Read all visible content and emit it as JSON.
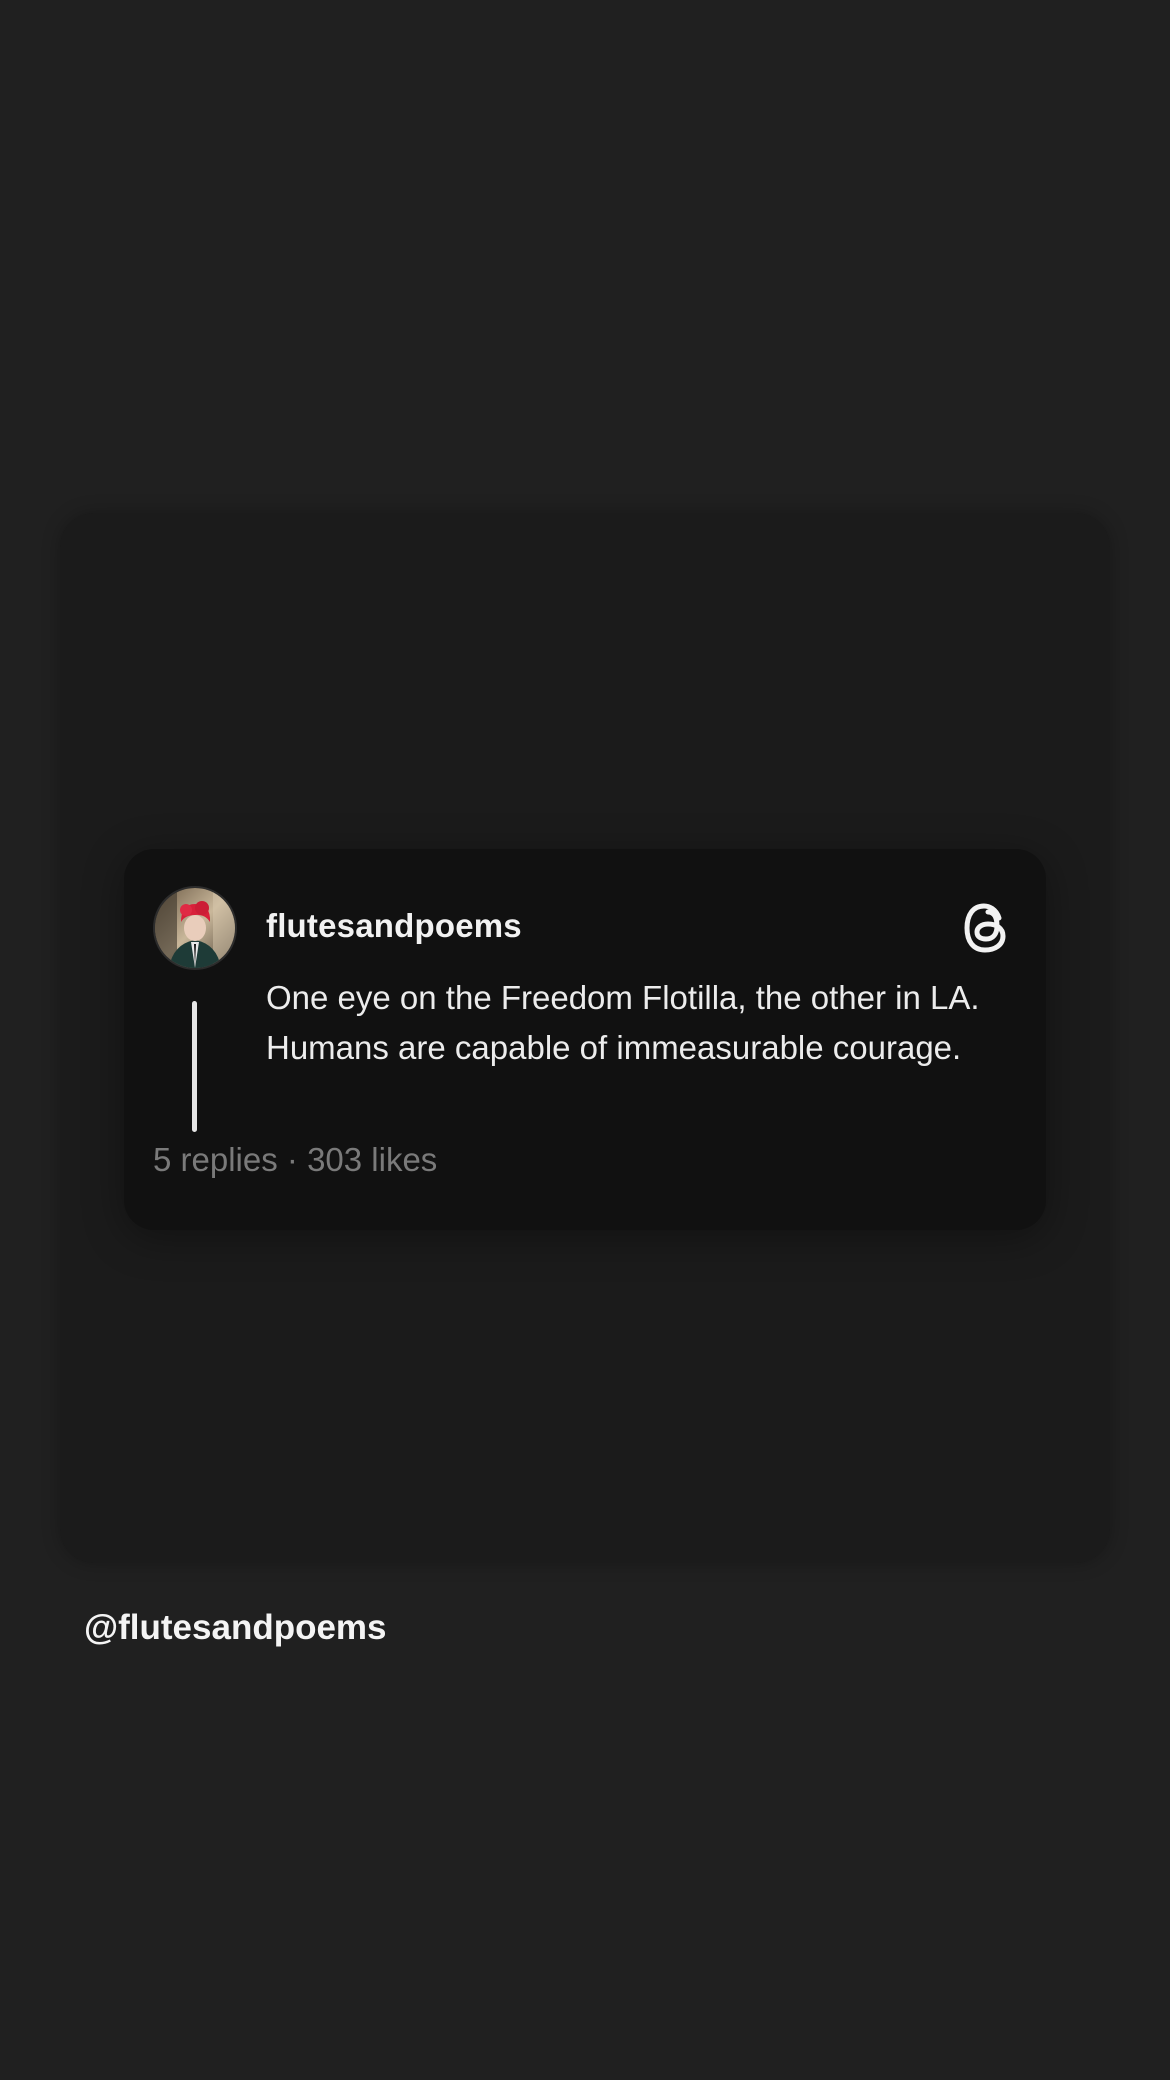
{
  "post": {
    "username": "flutesandpoems",
    "text": "One eye on the Freedom Flotilla, the other in LA. Humans are capable of immeasurable courage.",
    "replies": "5 replies",
    "separator": " · ",
    "likes": "303 likes",
    "avatar_icon": "profile-avatar",
    "app_icon": "threads-logo-icon"
  },
  "footer": {
    "handle": "@flutesandpoems"
  },
  "colors": {
    "background": "#202020",
    "panel": "#1b1b1b",
    "card": "#111111",
    "text_primary": "#f2f2f2",
    "text_muted": "#7a7a7a"
  }
}
